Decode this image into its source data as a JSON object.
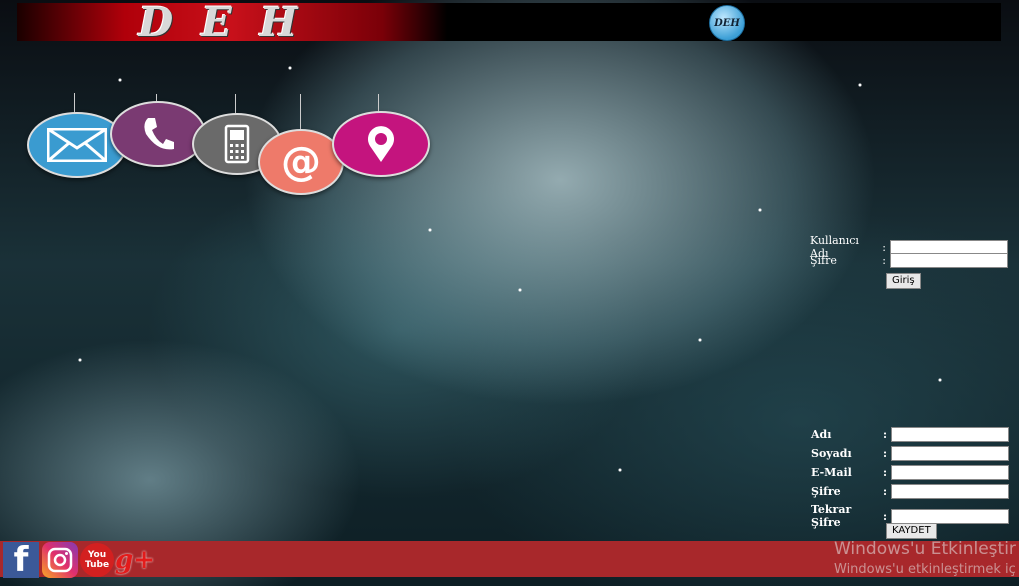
{
  "header": {
    "logo_text": "DEH",
    "badge_text": "DEH"
  },
  "contact_icons": [
    {
      "name": "mail-icon",
      "color": "#3a9bd0"
    },
    {
      "name": "phone-icon",
      "color": "#7a3a72"
    },
    {
      "name": "mobile-icon",
      "color": "#6a6a6a"
    },
    {
      "name": "at-icon",
      "color": "#ee7a6a"
    },
    {
      "name": "location-icon",
      "color": "#c4147e"
    }
  ],
  "login": {
    "username_label": "Kullanıcı Adı",
    "password_label": "Şifre",
    "colon": ":",
    "username_value": "",
    "password_value": "",
    "submit_label": "Giriş"
  },
  "register": {
    "first_name_label": "Adı",
    "last_name_label": "Soyadı",
    "email_label": "E-Mail",
    "password_label": "Şifre",
    "repeat_password_label": "Tekrar Şifre",
    "colon": ":",
    "submit_label": "KAYDET"
  },
  "footer": {
    "social": [
      "facebook",
      "instagram",
      "youtube",
      "google-plus"
    ],
    "youtube_text": "You Tube",
    "gplus_text": "g+",
    "facebook_text": "f",
    "bar_color": "#a8282b"
  },
  "watermark": {
    "title": "Windows'u Etkinleştir",
    "subtitle": "Windows'u etkinleştirmek iç"
  }
}
